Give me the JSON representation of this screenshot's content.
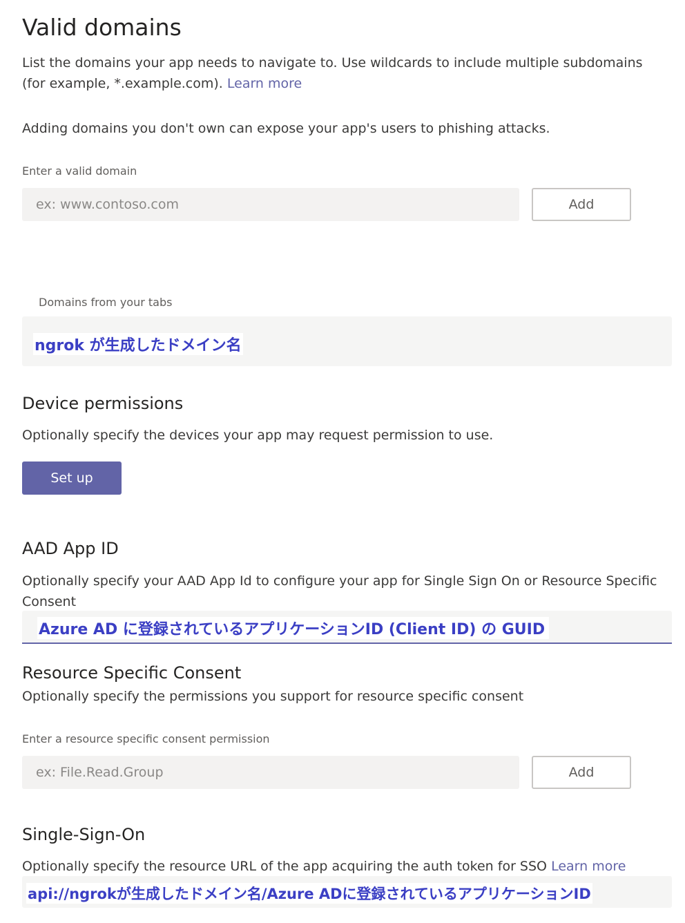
{
  "valid_domains": {
    "title": "Valid domains",
    "description": "List the domains your app needs to navigate to. Use wildcards to include multiple subdomains (for example, *.example.com).",
    "learn_more": "Learn more",
    "warning": "Adding domains you don't own can expose your app's users to phishing attacks.",
    "input_label": "Enter a valid domain",
    "input_placeholder": "ex: www.contoso.com",
    "add_label": "Add",
    "tabs_label": "Domains from your tabs",
    "tabs_value": "ngrok が生成したドメイン名"
  },
  "device_permissions": {
    "title": "Device permissions",
    "description": "Optionally specify the devices your app may request permission to use.",
    "setup_label": "Set up"
  },
  "aad_app_id": {
    "title": "AAD App ID",
    "description": "Optionally specify your AAD App Id to configure your app for Single Sign On or Resource Specific Consent",
    "value": "Azure AD に登録されているアプリケーションID (Client ID) の GUID"
  },
  "rsc": {
    "title": "Resource Specific Consent",
    "description": "Optionally specify the permissions you support for resource specific consent",
    "input_label": "Enter a resource specific consent permission",
    "input_placeholder": "ex: File.Read.Group",
    "add_label": "Add"
  },
  "sso": {
    "title": "Single-Sign-On",
    "description": "Optionally specify the resource URL of the app acquiring the auth token for SSO",
    "learn_more": "Learn more",
    "value": "api://ngrokが生成したドメイン名/Azure ADに登録されているアプリケーションID"
  },
  "colors": {
    "accent": "#6264a7",
    "annotation": "#3b3fc4",
    "input_bg": "#f3f2f1"
  }
}
